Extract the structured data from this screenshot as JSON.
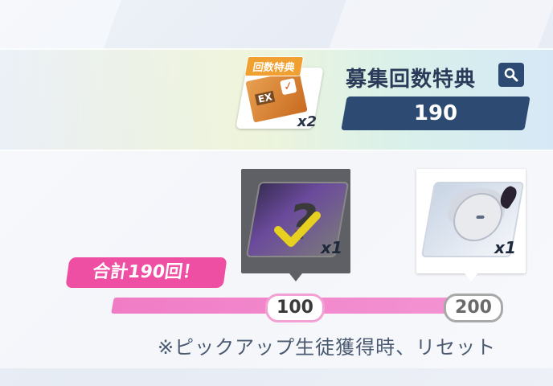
{
  "banner": {
    "ticket": {
      "tag_label": "回数特典",
      "box_label": "EX",
      "quantity": "x2"
    },
    "title": "募集回数特典",
    "count": "190"
  },
  "rewards": [
    {
      "name": "unknown-reward",
      "quantity": "x1",
      "claimed": true
    },
    {
      "name": "character-reward",
      "quantity": "x1",
      "claimed": false
    }
  ],
  "progress": {
    "total_label": "合計190回！",
    "current": 190,
    "max": 200,
    "milestones": [
      "100",
      "200"
    ]
  },
  "note": "※ピックアップ生徒獲得時、リセット",
  "colors": {
    "accent_pink": "#ef4fa2",
    "navy": "#2c4a72"
  }
}
